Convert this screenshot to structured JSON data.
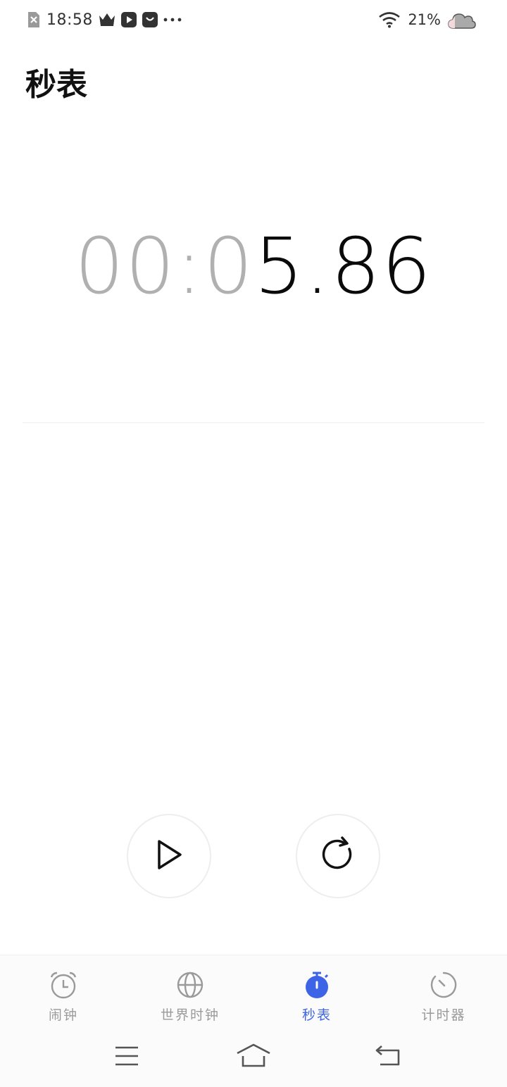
{
  "status_bar": {
    "time": "18:58",
    "battery": "21%",
    "icons": [
      "sim-error-icon",
      "crown-icon",
      "video-play-icon",
      "shopping-bag-icon",
      "more-dots-icon",
      "wifi-icon",
      "cloud-icon"
    ]
  },
  "header": {
    "title": "秒表"
  },
  "stopwatch": {
    "dim_part": "00:0",
    "bright_part": "5.86"
  },
  "controls": {
    "start_icon": "play-icon",
    "reset_icon": "reset-icon"
  },
  "bottom_nav": {
    "items": [
      {
        "label": "闹钟",
        "icon": "alarm-clock-icon",
        "active": false
      },
      {
        "label": "世界时钟",
        "icon": "globe-icon",
        "active": false
      },
      {
        "label": "秒表",
        "icon": "stopwatch-icon",
        "active": true
      },
      {
        "label": "计时器",
        "icon": "timer-icon",
        "active": false
      }
    ]
  },
  "colors": {
    "accent": "#3d64e6",
    "inactive": "#9a9a9a",
    "dim_digits": "#b0b0b0"
  }
}
